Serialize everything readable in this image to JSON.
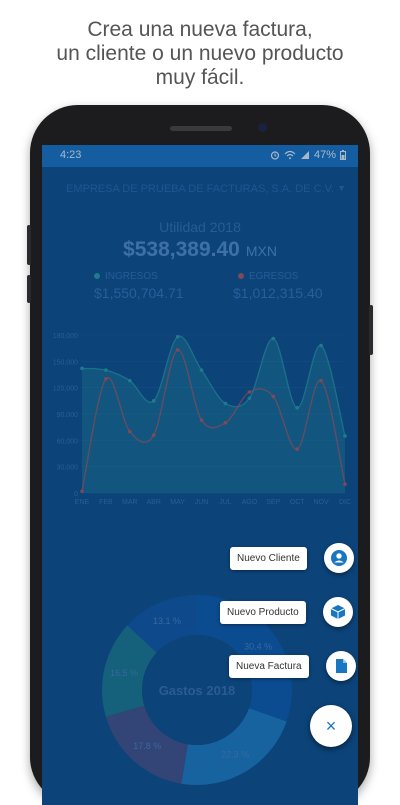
{
  "headline": {
    "line1": "Crea una nueva factura,",
    "line2": "un cliente o un nuevo producto",
    "line3": "muy fácil."
  },
  "status_bar": {
    "time": "4:23",
    "battery": "47%"
  },
  "company": {
    "name": "EMPRESA DE PRUEBA DE FACTURAS, S.A. DE C.V."
  },
  "utility": {
    "label": "Utilidad 2018",
    "value": "$538,389.40",
    "currency": "MXN"
  },
  "legend": {
    "income": {
      "label": "INGRESOS",
      "amount": "$1,550,704.71",
      "color": "#2aa3a3"
    },
    "expenses": {
      "label": "EGRESOS",
      "amount": "$1,012,315.40",
      "color": "#c2554e"
    }
  },
  "chart_data": {
    "type": "area",
    "categories": [
      "ENE",
      "FEB",
      "MAR",
      "ABR",
      "MAY",
      "JUN",
      "JUL",
      "AGO",
      "SEP",
      "OCT",
      "NOV",
      "DIC"
    ],
    "y_ticks": [
      "0",
      "30,000",
      "60,000",
      "90,000",
      "120,000",
      "150,000",
      "180,000"
    ],
    "ylim": [
      0,
      180000
    ],
    "series": [
      {
        "name": "INGRESOS",
        "color": "#2aa3a3",
        "values": [
          142000,
          140000,
          128000,
          105000,
          178000,
          140000,
          102000,
          108000,
          176000,
          97000,
          168000,
          65000
        ]
      },
      {
        "name": "EGRESOS",
        "color": "#c2554e",
        "values": [
          2000,
          130000,
          70000,
          66000,
          163000,
          83000,
          80000,
          115000,
          110000,
          50000,
          128000,
          10000
        ]
      }
    ]
  },
  "donut": {
    "title": "Gastos 2018",
    "slices": [
      {
        "label": "30.4 %",
        "value": 30.4,
        "color": "#0d5aa6"
      },
      {
        "label": "22.3 %",
        "value": 22.3,
        "color": "#1e7fbf"
      },
      {
        "label": "17.8 %",
        "value": 17.8,
        "color": "#4a4f80"
      },
      {
        "label": "16.5 %",
        "value": 16.5,
        "color": "#1c7a86"
      },
      {
        "label": "13.1 %",
        "value": 13.1,
        "color": "#1256a1"
      }
    ]
  },
  "fab": {
    "new_client": "Nuevo Cliente",
    "new_product": "Nuevo Producto",
    "new_invoice": "Nueva Factura",
    "close": "×"
  }
}
